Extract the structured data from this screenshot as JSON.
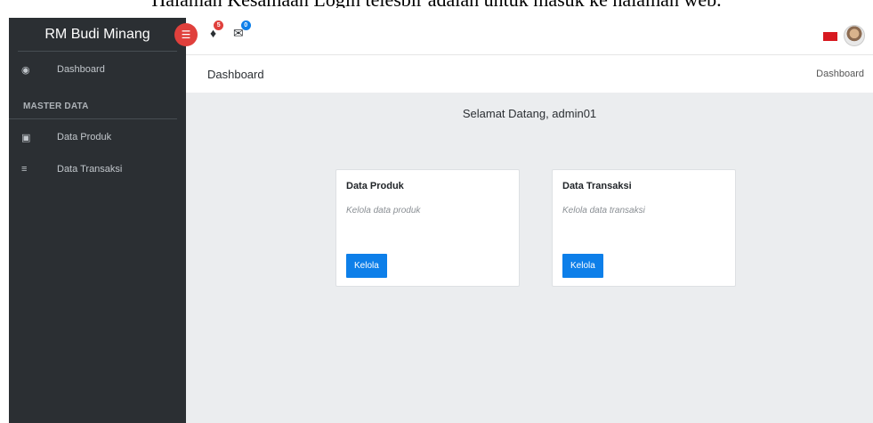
{
  "caption": "Halaman Kesamaan Login telesbir adalah untuk masuk ke halaman web.",
  "sidebar": {
    "brand": "RM Budi Minang",
    "items": [
      {
        "label": "Dashboard",
        "icon": "dashboard-icon"
      },
      {
        "label": "Data Produk",
        "icon": "product-icon"
      },
      {
        "label": "Data Transaksi",
        "icon": "list-icon"
      }
    ],
    "section_header": "MASTER DATA"
  },
  "topbar": {
    "notification_count": "5",
    "message_count": "0",
    "colors": {
      "toggle": "#e0403c",
      "notif_badge": "#e0403c",
      "msg_badge": "#0d7fe9"
    }
  },
  "breadcrumb": {
    "page_title": "Dashboard",
    "crumb": "Dashboard"
  },
  "main": {
    "welcome": "Selamat Datang, admin01",
    "cards": [
      {
        "title": "Data Produk",
        "description": "Kelola data produk",
        "button": "Kelola"
      },
      {
        "title": "Data Transaksi",
        "description": "Kelola data transaksi",
        "button": "Kelola"
      }
    ]
  },
  "colors": {
    "sidebar_bg": "#2b2f33",
    "content_bg": "#ebedef",
    "primary": "#0d7fe9"
  }
}
